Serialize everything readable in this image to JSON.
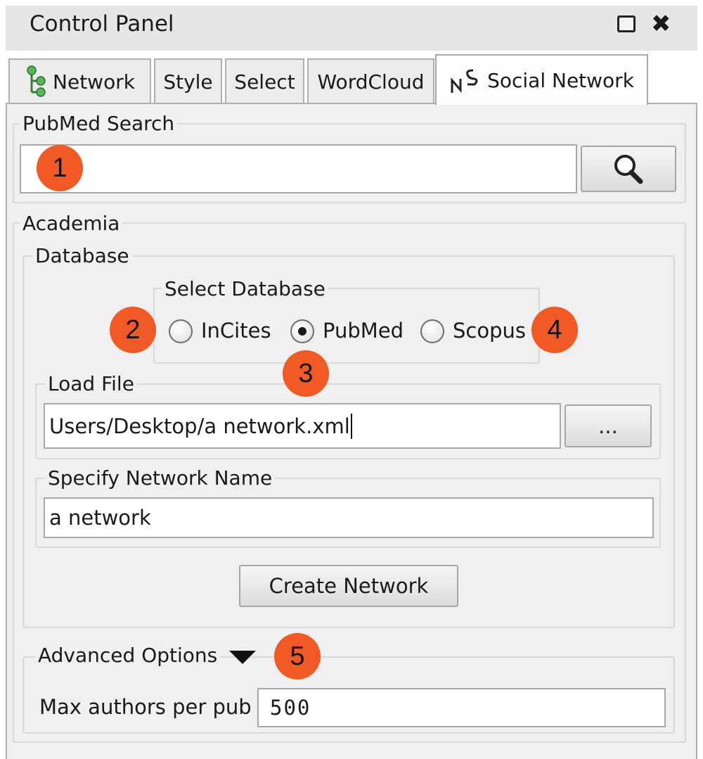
{
  "window": {
    "title": "Control Panel",
    "close_glyph": "✖"
  },
  "tabs": [
    {
      "label": "Network",
      "icon": "network-tree-icon"
    },
    {
      "label": "Style"
    },
    {
      "label": "Select"
    },
    {
      "label": "WordCloud"
    },
    {
      "label": "Social Network",
      "icon": "social-network-icon",
      "active": true
    }
  ],
  "pubmed": {
    "legend": "PubMed Search",
    "query": ""
  },
  "academia": {
    "legend": "Academia",
    "database": {
      "legend": "Database",
      "select_legend": "Select Database",
      "options": [
        "InCites",
        "PubMed",
        "Scopus"
      ],
      "selected": "PubMed"
    },
    "load_file": {
      "legend": "Load File",
      "value": "Users/Desktop/a network.xml",
      "browse_label": "..."
    },
    "network_name": {
      "legend": "Specify Network Name",
      "value": "a network"
    },
    "create_label": "Create Network"
  },
  "advanced": {
    "legend": "Advanced Options",
    "max_authors_label": "Max authors per pub",
    "max_authors_value": "500"
  },
  "callouts": [
    "1",
    "2",
    "3",
    "4",
    "5"
  ],
  "colors": {
    "callout": "#f15a24",
    "panel": "#f0f0f0",
    "titlebar": "#e6e6e6"
  }
}
